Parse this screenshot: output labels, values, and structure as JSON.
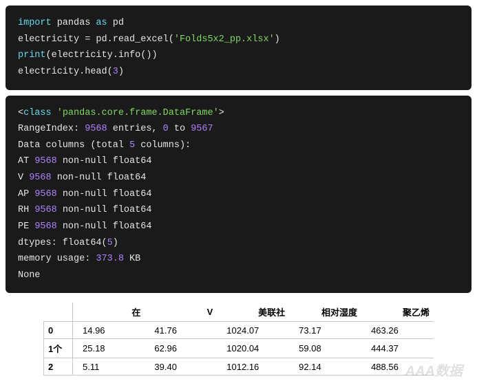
{
  "code1": {
    "l1_kw1": "import",
    "l1_plain1": " pandas ",
    "l1_kw2": "as",
    "l1_plain2": " pd",
    "l2_a": "electricity = pd.read_excel(",
    "l2_str": "'Folds5x2_pp.xlsx'",
    "l2_b": ")",
    "l3_a": "print",
    "l3_b": "(electricity.info())",
    "l4_a": "electricity.head(",
    "l4_num": "3",
    "l4_b": ")"
  },
  "out": {
    "l1_a": "<",
    "l1_cls": "class",
    "l1_b": " ",
    "l1_str": "'pandas.core.frame.DataFrame'",
    "l1_c": ">",
    "l2_a": "RangeIndex: ",
    "l2_n1": "9568",
    "l2_b": " entries, ",
    "l2_n2": "0",
    "l2_c": " to ",
    "l2_n3": "9567",
    "l3_a": "Data columns (total ",
    "l3_n1": "5",
    "l3_b": " columns):",
    "l4_a": "AT ",
    "l4_n": "9568",
    "l4_b": " non-null float64",
    "l5_a": "V ",
    "l5_n": "9568",
    "l5_b": " non-null float64",
    "l6_a": "AP ",
    "l6_n": "9568",
    "l6_b": " non-null float64",
    "l7_a": "RH ",
    "l7_n": "9568",
    "l7_b": " non-null float64",
    "l8_a": "PE ",
    "l8_n": "9568",
    "l8_b": " non-null float64",
    "l9_a": "dtypes: float64(",
    "l9_n": "5",
    "l9_b": ")",
    "l10_a": "memory usage: ",
    "l10_n": "373.8",
    "l10_b": " KB",
    "l11": "None"
  },
  "table": {
    "headers": [
      "",
      "在",
      "V",
      "美联社",
      "相对湿度",
      "聚乙烯"
    ],
    "rows": [
      {
        "idx": "0",
        "cells": [
          "14.96",
          "41.76",
          "1024.07",
          "73.17",
          "463.26"
        ]
      },
      {
        "idx": "1个",
        "cells": [
          "25.18",
          "62.96",
          "1020.04",
          "59.08",
          "444.37"
        ]
      },
      {
        "idx": "2",
        "cells": [
          "5.11",
          "39.40",
          "1012.16",
          "92.14",
          "488.56"
        ]
      }
    ]
  },
  "watermark": "AAA数据"
}
